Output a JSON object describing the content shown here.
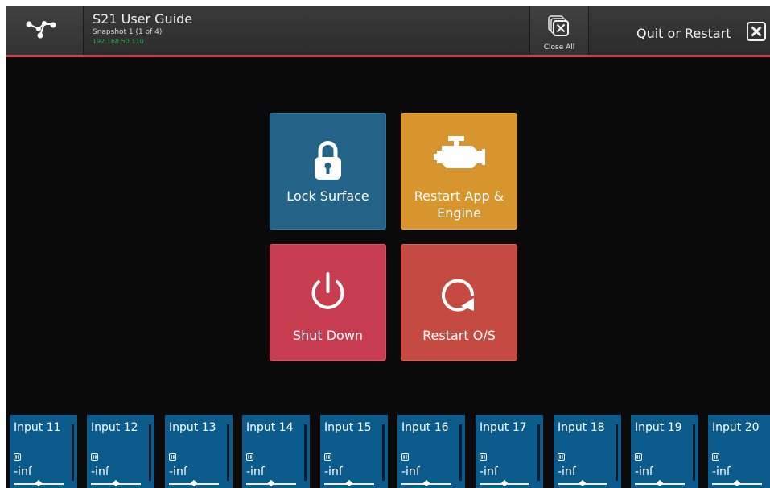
{
  "header": {
    "title": "S21 User Guide",
    "snapshot": "Snapshot 1 (1 of 4)",
    "ip": "192.168.50.110",
    "close_all_label": "Close All",
    "quit_label": "Quit or Restart"
  },
  "tiles": {
    "lock": "Lock Surface",
    "restart_line1": "Restart App &",
    "restart_line2": "Engine",
    "shutdown": "Shut Down",
    "restart_os": "Restart O/S"
  },
  "colors": {
    "lock": "#236388",
    "restart_app": "#d9952d",
    "shutdown": "#c83c50",
    "restart_os": "#c44a42",
    "accent_line": "#c8424c",
    "strip": "#0b5b8d"
  },
  "strips": [
    {
      "name": "Input 11",
      "level": "-inf"
    },
    {
      "name": "Input 12",
      "level": "-inf"
    },
    {
      "name": "Input 13",
      "level": "-inf"
    },
    {
      "name": "Input 14",
      "level": "-inf"
    },
    {
      "name": "Input 15",
      "level": "-inf"
    },
    {
      "name": "Input 16",
      "level": "-inf"
    },
    {
      "name": "Input 17",
      "level": "-inf"
    },
    {
      "name": "Input 18",
      "level": "-inf"
    },
    {
      "name": "Input 19",
      "level": "-inf"
    },
    {
      "name": "Input 20",
      "level": "-inf"
    }
  ]
}
